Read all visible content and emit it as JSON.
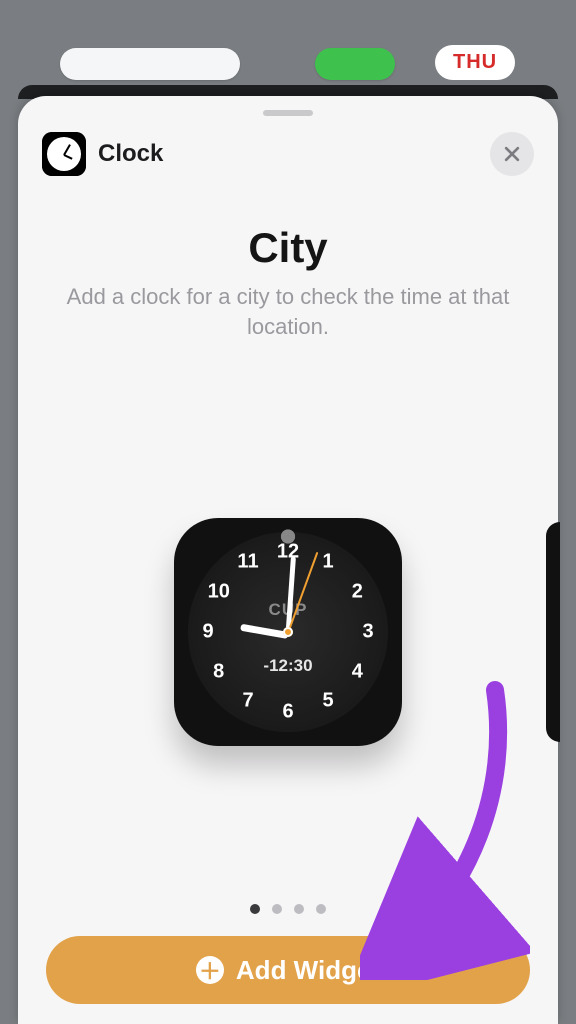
{
  "home": {
    "thu_badge": "THU"
  },
  "sheet": {
    "app_name": "Clock",
    "title": "City",
    "description": "Add a clock for a city to check the time at that location.",
    "widget": {
      "city_code": "CUP",
      "offset": "-12:30",
      "numerals": [
        "12",
        "1",
        "2",
        "3",
        "4",
        "5",
        "6",
        "7",
        "8",
        "9",
        "10",
        "11"
      ]
    },
    "page_count": 4,
    "page_index": 0,
    "add_button": "Add Widget"
  },
  "colors": {
    "accent": "#e2a24a",
    "arrow": "#9a3fe0"
  }
}
